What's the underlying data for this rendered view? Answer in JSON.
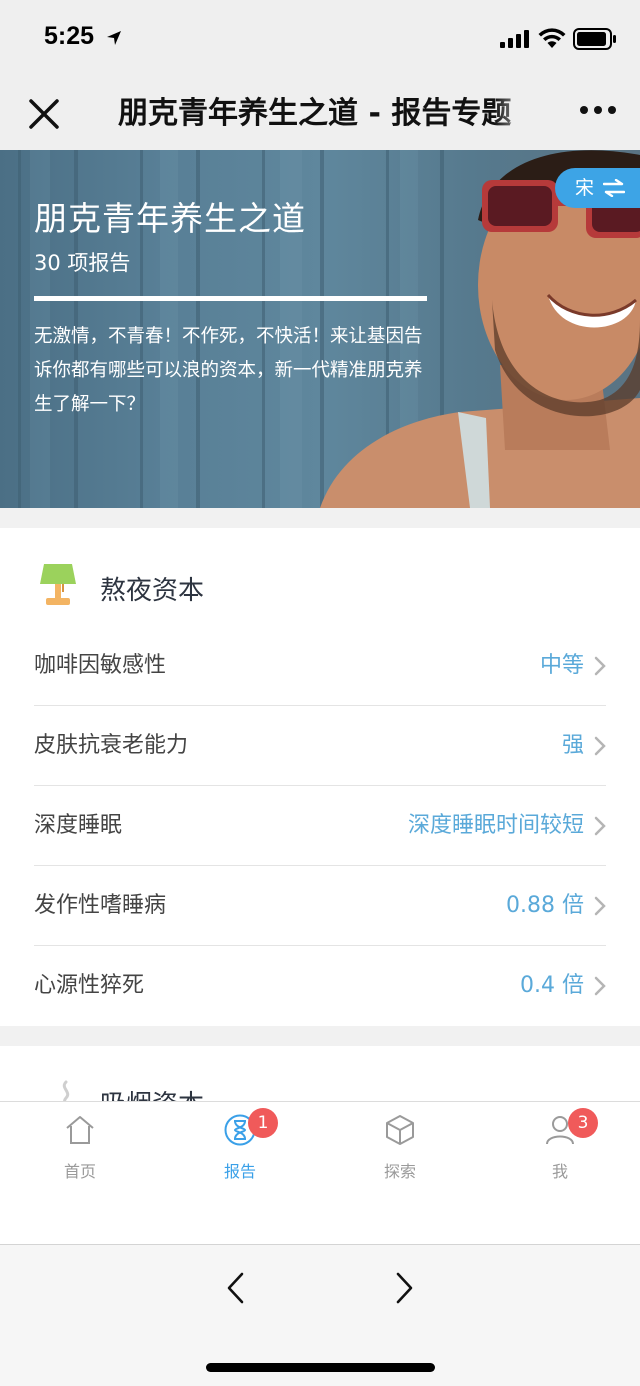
{
  "status_bar": {
    "time": "5:25"
  },
  "nav": {
    "title": "朋克青年养生之道 - 报告专题"
  },
  "hero": {
    "title": "朋克青年养生之道",
    "count": "30 项报告",
    "description": "无激情，不青春！不作死，不快活！来让基因告诉你都有哪些可以浪的资本，新一代精准朋克养生了解一下？",
    "voice_label": "宋"
  },
  "section": {
    "title": "熬夜资本",
    "rows": [
      {
        "label": "咖啡因敏感性",
        "value": "中等"
      },
      {
        "label": "皮肤抗衰老能力",
        "value": "强"
      },
      {
        "label": "深度睡眠",
        "value": "深度睡眠时间较短"
      },
      {
        "label": "发作性嗜睡病",
        "value": "0.88 倍"
      },
      {
        "label": "心源性猝死",
        "value": "0.4 倍"
      }
    ]
  },
  "next_section": {
    "title": "吸烟资本"
  },
  "tabs": [
    {
      "label": "首页",
      "badge": ""
    },
    {
      "label": "报告",
      "badge": "1"
    },
    {
      "label": "探索",
      "badge": ""
    },
    {
      "label": "我",
      "badge": "3"
    }
  ],
  "colors": {
    "accent": "#3aa0e8",
    "value": "#5aa9d9",
    "badge": "#f05a5a",
    "voice_tag": "#3da4e6"
  }
}
